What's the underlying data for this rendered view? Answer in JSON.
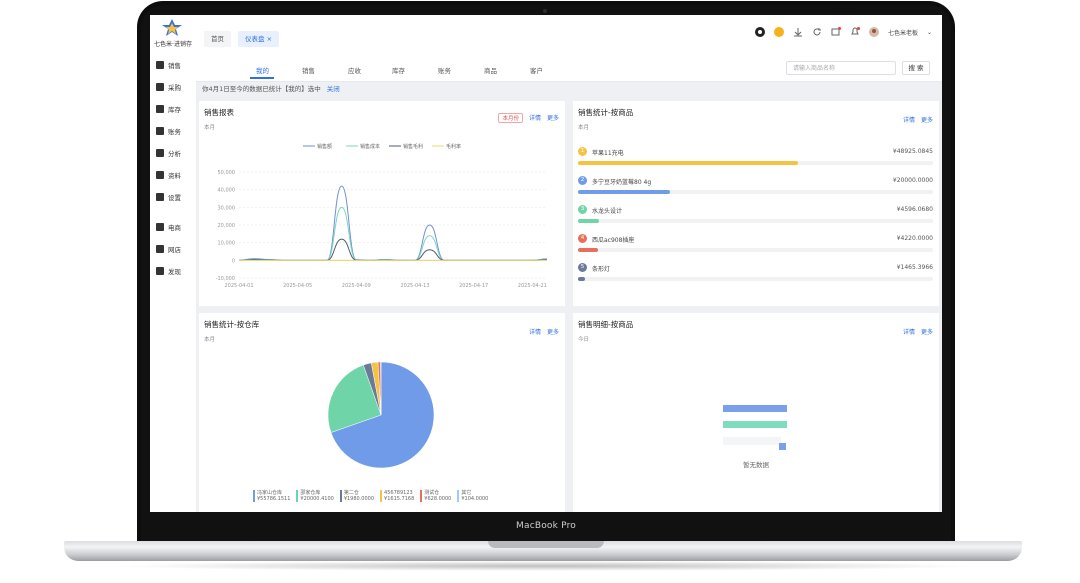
{
  "device_label": "MacBook Pro",
  "sidebar": {
    "logo_text": "七色米·进销存",
    "items": [
      {
        "label": "销售",
        "icon": "cart-icon"
      },
      {
        "label": "采购",
        "icon": "purchase-icon"
      },
      {
        "label": "库存",
        "icon": "warehouse-icon"
      },
      {
        "label": "账务",
        "icon": "ledger-icon"
      },
      {
        "label": "分析",
        "icon": "analysis-icon"
      },
      {
        "label": "资料",
        "icon": "data-icon"
      },
      {
        "label": "设置",
        "icon": "gear-icon"
      },
      {
        "label": "电商",
        "icon": "ecommerce-icon"
      },
      {
        "label": "网店",
        "icon": "shop-icon"
      },
      {
        "label": "发现",
        "icon": "compass-icon"
      }
    ]
  },
  "topbar": {
    "tabs": [
      {
        "label": "首页"
      },
      {
        "label": "仪表盘 ×"
      }
    ],
    "user": "七色米老板"
  },
  "subnav": {
    "tabs": [
      "我的",
      "销售",
      "应收",
      "库存",
      "账务",
      "商品",
      "客户"
    ],
    "active": 0,
    "search_placeholder": "请输入商品名称",
    "search_button": "搜 索"
  },
  "notice": {
    "text": "你4月1日至今的数据已统计【我的】选中",
    "link": "关闭"
  },
  "sales_card": {
    "title": "销售报表",
    "period": "本月",
    "toggle": "本月份",
    "detail": "详情",
    "more": "更多"
  },
  "product_card": {
    "title": "销售统计-按商品",
    "period": "本月",
    "detail": "详情",
    "more": "更多",
    "rows": [
      {
        "rank": "1",
        "name": "苹果11充电",
        "value": "¥48925.0845",
        "pct": 0.62,
        "color": "#f4c342"
      },
      {
        "rank": "2",
        "name": "多宁豆牙奶蓝莓80 4g",
        "value": "¥20000.0000",
        "pct": 0.26,
        "color": "#6f9be8"
      },
      {
        "rank": "3",
        "name": "水龙头设计",
        "value": "¥4596.0680",
        "pct": 0.06,
        "color": "#6fd5a8"
      },
      {
        "rank": "4",
        "name": "西瓜ac908插座",
        "value": "¥4220.0000",
        "pct": 0.055,
        "color": "#e8705a"
      },
      {
        "rank": "5",
        "name": "条形灯",
        "value": "¥1465.3966",
        "pct": 0.02,
        "color": "#6b7a99"
      }
    ]
  },
  "warehouse_card": {
    "title": "销售统计-按仓库",
    "period": "本月",
    "detail": "详情",
    "more": "更多",
    "legend": [
      {
        "name": "冯家山仓库",
        "value": "¥55786.1511",
        "color": "#6f9be8"
      },
      {
        "name": "邵家仓库",
        "value": "¥20000.4100",
        "color": "#6fd5a8"
      },
      {
        "name": "第二仓",
        "value": "¥1980.0000",
        "color": "#6b7a99"
      },
      {
        "name": "456789123",
        "value": "¥1615.7168",
        "color": "#f4c342"
      },
      {
        "name": "测试仓",
        "value": "¥628.0000",
        "color": "#e8705a"
      },
      {
        "name": "其它",
        "value": "¥104.0000",
        "color": "#a5c8f0"
      }
    ]
  },
  "detail_card": {
    "title": "销售明细-按商品",
    "period": "今日",
    "detail": "详情",
    "more": "更多",
    "empty": "暂无数据"
  },
  "chart_data": [
    {
      "type": "line",
      "x": [
        "2025-04-01",
        "2025-04-02",
        "2025-04-03",
        "2025-04-04",
        "2025-04-05",
        "2025-04-06",
        "2025-04-07",
        "2025-04-08",
        "2025-04-09",
        "2025-04-10",
        "2025-04-11",
        "2025-04-12",
        "2025-04-13",
        "2025-04-14",
        "2025-04-15",
        "2025-04-16",
        "2025-04-17",
        "2025-04-18",
        "2025-04-19",
        "2025-04-20",
        "2025-04-21",
        "2025-04-22"
      ],
      "x_tick_labels": [
        "2025-04-01",
        "2025-04-05",
        "2025-04-09",
        "2025-04-13",
        "2025-04-17",
        "2025-04-21"
      ],
      "ylim": [
        -10000,
        50000
      ],
      "y_ticks": [
        50000,
        40000,
        30000,
        20000,
        10000,
        0,
        -10000
      ],
      "y_tick_labels": [
        "50,000",
        "40,000",
        "30,000",
        "20,000",
        "10,000",
        "0",
        "-10,000"
      ],
      "legend": "top",
      "series": [
        {
          "name": "销售额",
          "color": "#6f8fd8",
          "values": [
            0,
            1000,
            500,
            0,
            0,
            0,
            0,
            42000,
            300,
            0,
            500,
            0,
            0,
            20000,
            0,
            0,
            0,
            0,
            0,
            0,
            0,
            800
          ]
        },
        {
          "name": "销售成本",
          "color": "#7fd6c0",
          "values": [
            0,
            600,
            300,
            0,
            0,
            0,
            0,
            30000,
            200,
            0,
            400,
            0,
            0,
            14000,
            0,
            0,
            0,
            0,
            0,
            0,
            0,
            500
          ]
        },
        {
          "name": "销售毛利",
          "color": "#505a70",
          "values": [
            0,
            400,
            200,
            0,
            0,
            0,
            0,
            12000,
            100,
            0,
            100,
            0,
            0,
            6000,
            0,
            0,
            0,
            0,
            0,
            0,
            0,
            300
          ]
        },
        {
          "name": "毛利率",
          "color": "#f2d76c",
          "values": [
            0,
            0,
            0,
            0,
            0,
            0,
            0,
            0,
            0,
            0,
            0,
            0,
            0,
            0,
            0,
            0,
            0,
            0,
            0,
            0,
            0,
            0
          ]
        }
      ]
    },
    {
      "type": "pie",
      "categories": [
        "冯家山仓库",
        "邵家仓库",
        "第二仓",
        "456789123",
        "测试仓",
        "其它"
      ],
      "values": [
        55786.15,
        20000.41,
        1980.0,
        1615.72,
        628.0,
        104.0
      ],
      "colors": [
        "#6f9be8",
        "#6fd5a8",
        "#6b7a99",
        "#f4c342",
        "#e8705a",
        "#a5c8f0"
      ]
    }
  ]
}
